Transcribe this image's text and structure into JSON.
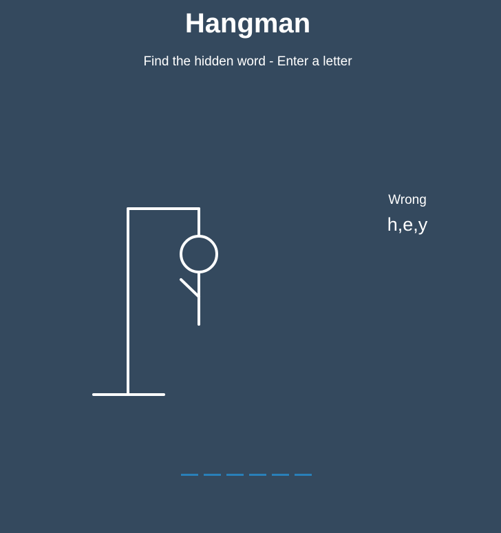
{
  "header": {
    "title": "Hangman",
    "subtitle": "Find the hidden word - Enter a letter"
  },
  "wrong": {
    "label": "Wrong",
    "letters": "h,e,y",
    "count": 3
  },
  "word": {
    "length": 6,
    "revealed": [
      "",
      "",
      "",
      "",
      "",
      ""
    ]
  },
  "colors": {
    "background": "#34495e",
    "foreground": "#ffffff",
    "slot_underline": "#2980b9"
  }
}
